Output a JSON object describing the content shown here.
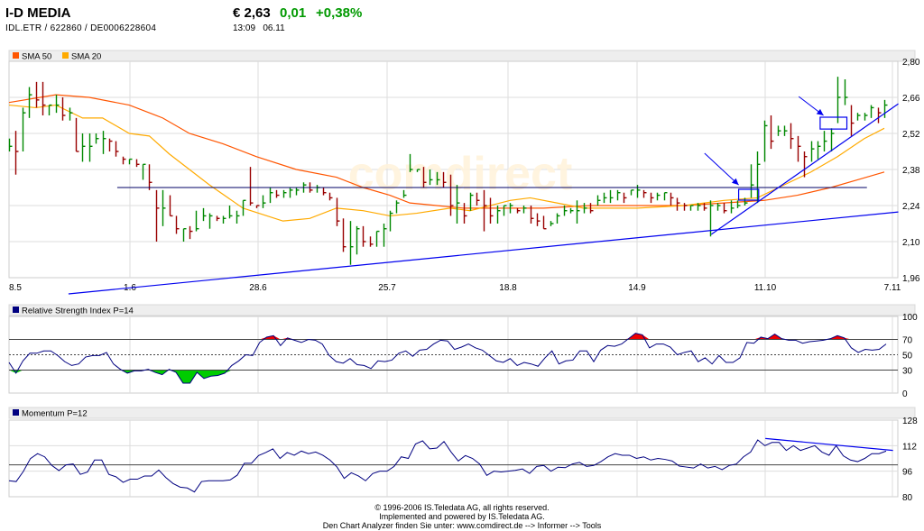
{
  "header": {
    "title": "I-D MEDIA",
    "identifiers": "IDL.ETR  /  622860  /  DE0006228604",
    "price": "€ 2,63",
    "change": "0,01",
    "change_pct": "+0,38%",
    "time": "13:09",
    "date": "06.11"
  },
  "colors": {
    "up": "#008800",
    "down": "#990000",
    "sma50": "#ff5500",
    "sma20": "#ffaa00",
    "trend": "#0000ee",
    "rsi": "#000080",
    "overbought": "#ee0000",
    "oversold": "#00cc00"
  },
  "watermark": "comdirect",
  "footer": {
    "line1": "© 1996-2006 IS.Teledata AG, all rights reserved.",
    "line2": "Implemented and powered by IS.Teledata AG.",
    "line3": "Den Chart Analyzer finden Sie unter: www.comdirect.de --> Informer --> Tools"
  },
  "chart_data": [
    {
      "type": "ohlc",
      "legend": [
        "SMA 50",
        "SMA 20"
      ],
      "x_tick_labels": [
        "8.5",
        "1.6",
        "28.6",
        "25.7",
        "18.8",
        "14.9",
        "11.10",
        "7.11"
      ],
      "y_tick_labels": [
        "2,80",
        "2,66",
        "2,52",
        "2,38",
        "2,24",
        "2,10",
        "1,96"
      ],
      "ylim": [
        1.96,
        2.8
      ],
      "grid": true,
      "bars_hlc": [
        [
          2.5,
          2.45,
          2.47
        ],
        [
          2.53,
          2.36,
          2.45
        ],
        [
          2.62,
          2.45,
          2.6
        ],
        [
          2.7,
          2.58,
          2.67
        ],
        [
          2.72,
          2.62,
          2.65
        ],
        [
          2.72,
          2.59,
          2.63
        ],
        [
          2.63,
          2.59,
          2.63
        ],
        [
          2.67,
          2.6,
          2.63
        ],
        [
          2.66,
          2.57,
          2.59
        ],
        [
          2.62,
          2.57,
          2.6
        ],
        [
          2.58,
          2.45,
          2.45
        ],
        [
          2.52,
          2.41,
          2.47
        ],
        [
          2.52,
          2.41,
          2.47
        ],
        [
          2.52,
          2.48,
          2.5
        ],
        [
          2.53,
          2.44,
          2.5
        ],
        [
          2.5,
          2.45,
          2.49
        ],
        [
          2.49,
          2.43,
          2.45
        ],
        [
          2.43,
          2.4,
          2.42
        ],
        [
          2.42,
          2.4,
          2.42
        ],
        [
          2.42,
          2.39,
          2.4
        ],
        [
          2.4,
          2.34,
          2.4
        ],
        [
          2.4,
          2.3,
          2.33
        ],
        [
          2.3,
          2.1,
          2.23
        ],
        [
          2.3,
          2.16,
          2.23
        ],
        [
          2.28,
          2.2,
          2.2
        ],
        [
          2.2,
          2.13,
          2.15
        ],
        [
          2.15,
          2.1,
          2.15
        ],
        [
          2.16,
          2.11,
          2.14
        ],
        [
          2.22,
          2.14,
          2.15
        ],
        [
          2.23,
          2.18,
          2.2
        ],
        [
          2.21,
          2.15,
          2.2
        ],
        [
          2.2,
          2.18,
          2.19
        ],
        [
          2.2,
          2.17,
          2.19
        ],
        [
          2.24,
          2.19,
          2.2
        ],
        [
          2.22,
          2.17,
          2.2
        ],
        [
          2.26,
          2.2,
          2.26
        ],
        [
          2.39,
          2.24,
          2.25
        ],
        [
          2.24,
          2.23,
          2.24
        ],
        [
          2.28,
          2.23,
          2.25
        ],
        [
          2.31,
          2.25,
          2.29
        ],
        [
          2.3,
          2.27,
          2.28
        ],
        [
          2.3,
          2.27,
          2.29
        ],
        [
          2.31,
          2.27,
          2.3
        ],
        [
          2.31,
          2.28,
          2.3
        ],
        [
          2.33,
          2.29,
          2.32
        ],
        [
          2.33,
          2.29,
          2.3
        ],
        [
          2.32,
          2.29,
          2.31
        ],
        [
          2.31,
          2.28,
          2.29
        ],
        [
          2.29,
          2.26,
          2.27
        ],
        [
          2.27,
          2.16,
          2.18
        ],
        [
          2.19,
          2.06,
          2.08
        ],
        [
          2.18,
          2.01,
          2.08
        ],
        [
          2.16,
          2.05,
          2.15
        ],
        [
          2.16,
          2.08,
          2.1
        ],
        [
          2.12,
          2.08,
          2.09
        ],
        [
          2.14,
          2.08,
          2.14
        ],
        [
          2.17,
          2.08,
          2.15
        ],
        [
          2.22,
          2.14,
          2.21
        ],
        [
          2.26,
          2.21,
          2.25
        ],
        [
          2.3,
          2.27,
          2.28
        ],
        [
          2.44,
          2.37,
          2.38
        ],
        [
          2.38,
          2.37,
          2.38
        ],
        [
          2.39,
          2.31,
          2.33
        ],
        [
          2.38,
          2.32,
          2.34
        ],
        [
          2.37,
          2.32,
          2.34
        ],
        [
          2.37,
          2.31,
          2.33
        ],
        [
          2.36,
          2.2,
          2.24
        ],
        [
          2.32,
          2.17,
          2.25
        ],
        [
          2.25,
          2.17,
          2.2
        ],
        [
          2.29,
          2.22,
          2.28
        ],
        [
          2.29,
          2.24,
          2.26
        ],
        [
          2.3,
          2.14,
          2.24
        ],
        [
          2.27,
          2.17,
          2.2
        ],
        [
          2.24,
          2.17,
          2.22
        ],
        [
          2.24,
          2.2,
          2.24
        ],
        [
          2.25,
          2.21,
          2.24
        ],
        [
          2.23,
          2.21,
          2.22
        ],
        [
          2.24,
          2.21,
          2.23
        ],
        [
          2.24,
          2.17,
          2.19
        ],
        [
          2.21,
          2.16,
          2.18
        ],
        [
          2.2,
          2.15,
          2.15
        ],
        [
          2.18,
          2.16,
          2.17
        ],
        [
          2.21,
          2.17,
          2.2
        ],
        [
          2.24,
          2.2,
          2.22
        ],
        [
          2.23,
          2.21,
          2.22
        ],
        [
          2.26,
          2.17,
          2.22
        ],
        [
          2.25,
          2.21,
          2.23
        ],
        [
          2.25,
          2.21,
          2.22
        ],
        [
          2.28,
          2.24,
          2.26
        ],
        [
          2.29,
          2.25,
          2.27
        ],
        [
          2.3,
          2.25,
          2.27
        ],
        [
          2.3,
          2.26,
          2.29
        ],
        [
          2.29,
          2.25,
          2.27
        ],
        [
          2.3,
          2.28,
          2.3
        ],
        [
          2.32,
          2.27,
          2.3
        ],
        [
          2.3,
          2.27,
          2.29
        ],
        [
          2.29,
          2.25,
          2.27
        ],
        [
          2.29,
          2.26,
          2.28
        ],
        [
          2.29,
          2.26,
          2.29
        ],
        [
          2.29,
          2.24,
          2.27
        ],
        [
          2.27,
          2.22,
          2.25
        ],
        [
          2.25,
          2.22,
          2.24
        ],
        [
          2.24,
          2.22,
          2.24
        ],
        [
          2.25,
          2.22,
          2.24
        ],
        [
          2.25,
          2.22,
          2.23
        ],
        [
          2.26,
          2.12,
          2.24
        ],
        [
          2.25,
          2.22,
          2.24
        ],
        [
          2.25,
          2.21,
          2.22
        ],
        [
          2.26,
          2.21,
          2.23
        ],
        [
          2.26,
          2.23,
          2.24
        ],
        [
          2.27,
          2.24,
          2.25
        ],
        [
          2.4,
          2.27,
          2.32
        ],
        [
          2.45,
          2.25,
          2.4
        ],
        [
          2.57,
          2.41,
          2.55
        ],
        [
          2.59,
          2.46,
          2.49
        ],
        [
          2.55,
          2.51,
          2.53
        ],
        [
          2.55,
          2.51,
          2.53
        ],
        [
          2.56,
          2.46,
          2.5
        ],
        [
          2.51,
          2.41,
          2.47
        ],
        [
          2.45,
          2.35,
          2.43
        ],
        [
          2.49,
          2.41,
          2.46
        ],
        [
          2.49,
          2.42,
          2.47
        ],
        [
          2.53,
          2.45,
          2.49
        ],
        [
          2.54,
          2.45,
          2.52
        ],
        [
          2.74,
          2.56,
          2.66
        ],
        [
          2.73,
          2.63,
          2.66
        ],
        [
          2.63,
          2.51,
          2.56
        ],
        [
          2.6,
          2.57,
          2.59
        ],
        [
          2.6,
          2.57,
          2.59
        ],
        [
          2.63,
          2.58,
          2.62
        ],
        [
          2.62,
          2.56,
          2.6
        ],
        [
          2.65,
          2.58,
          2.63
        ]
      ],
      "sma50": [
        [
          0,
          2.64
        ],
        [
          7,
          2.67
        ],
        [
          12,
          2.66
        ],
        [
          18,
          2.63
        ],
        [
          23,
          2.58
        ],
        [
          27,
          2.52
        ],
        [
          32,
          2.48
        ],
        [
          37,
          2.43
        ],
        [
          43,
          2.38
        ],
        [
          49,
          2.35
        ],
        [
          53,
          2.31
        ],
        [
          57,
          2.28
        ],
        [
          60,
          2.25
        ],
        [
          64,
          2.24
        ],
        [
          68,
          2.23
        ],
        [
          75,
          2.23
        ],
        [
          80,
          2.23
        ],
        [
          87,
          2.24
        ],
        [
          94,
          2.24
        ],
        [
          101,
          2.24
        ],
        [
          107,
          2.25
        ],
        [
          113,
          2.26
        ],
        [
          118,
          2.28
        ],
        [
          123,
          2.31
        ],
        [
          127,
          2.34
        ],
        [
          131,
          2.37
        ]
      ],
      "sma20": [
        [
          0,
          2.63
        ],
        [
          4,
          2.62
        ],
        [
          7,
          2.63
        ],
        [
          11,
          2.58
        ],
        [
          14,
          2.58
        ],
        [
          18,
          2.52
        ],
        [
          21,
          2.51
        ],
        [
          24,
          2.44
        ],
        [
          30,
          2.32
        ],
        [
          35,
          2.23
        ],
        [
          41,
          2.18
        ],
        [
          45,
          2.19
        ],
        [
          49,
          2.23
        ],
        [
          53,
          2.22
        ],
        [
          57,
          2.2
        ],
        [
          61,
          2.21
        ],
        [
          66,
          2.23
        ],
        [
          69,
          2.22
        ],
        [
          75,
          2.26
        ],
        [
          78,
          2.27
        ],
        [
          82,
          2.25
        ],
        [
          86,
          2.23
        ],
        [
          94,
          2.23
        ],
        [
          101,
          2.24
        ],
        [
          107,
          2.26
        ],
        [
          112,
          2.27
        ],
        [
          116,
          2.32
        ],
        [
          120,
          2.37
        ],
        [
          124,
          2.43
        ],
        [
          128,
          2.5
        ],
        [
          131,
          2.54
        ]
      ],
      "annotations": {
        "hline": {
          "from": 16.2,
          "to": 128.4,
          "price": 2.31
        },
        "lines": [
          {
            "x1": 8.9,
            "p1": 1.897,
            "x2": 133.1,
            "p2": 2.215
          },
          {
            "x1": 105.1,
            "p1": 2.128,
            "x2": 133.1,
            "p2": 2.635
          }
        ],
        "rects": [
          {
            "x1": 109.2,
            "x2": 112.2,
            "p1": 2.303,
            "p2": 2.261
          },
          {
            "x1": 121.4,
            "x2": 125.4,
            "p1": 2.583,
            "p2": 2.537
          }
        ],
        "arrows": [
          {
            "x1": 104.1,
            "p1": 2.443,
            "x2": 109.2,
            "p2": 2.32
          },
          {
            "x1": 118.2,
            "p1": 2.663,
            "x2": 121.9,
            "p2": 2.59
          }
        ]
      }
    },
    {
      "type": "line",
      "title": "Relative Strength Index P=14",
      "y_tick_labels": [
        "100",
        "70",
        "50",
        "30",
        "0"
      ],
      "ylim": [
        0,
        100
      ],
      "levels": [
        30,
        50,
        70
      ],
      "values": [
        40,
        26,
        42,
        52,
        52,
        55,
        55,
        49,
        41,
        36,
        38,
        47,
        49,
        49,
        53,
        38,
        31,
        26,
        29,
        29,
        31,
        27,
        24,
        31,
        27,
        13,
        13,
        27,
        19,
        22,
        23,
        26,
        36,
        42,
        50,
        49,
        66,
        73,
        75,
        62,
        72,
        69,
        66,
        70,
        69,
        64,
        49,
        41,
        39,
        45,
        37,
        36,
        32,
        42,
        41,
        43,
        52,
        55,
        48,
        56,
        57,
        64,
        69,
        68,
        57,
        60,
        64,
        59,
        56,
        49,
        42,
        40,
        45,
        36,
        40,
        38,
        35,
        46,
        55,
        38,
        42,
        43,
        55,
        55,
        41,
        56,
        62,
        61,
        64,
        71,
        78,
        76,
        59,
        64,
        64,
        60,
        50,
        53,
        55,
        41,
        46,
        38,
        49,
        40,
        40,
        46,
        66,
        65,
        73,
        71,
        77,
        71,
        69,
        69,
        65,
        67,
        68,
        69,
        71,
        75,
        72,
        59,
        53,
        57,
        56,
        57,
        64
      ]
    },
    {
      "type": "line",
      "title": "Momentum P=12",
      "y_tick_labels": [
        "128",
        "112",
        "96",
        "80"
      ],
      "ylim": [
        80,
        128
      ],
      "baseline": 100,
      "values": [
        90,
        89.5,
        95.8,
        103.9,
        107,
        105,
        99.6,
        96.4,
        100,
        100.5,
        94,
        95.5,
        103,
        103,
        94,
        92.5,
        89,
        91,
        91,
        93,
        93,
        96.7,
        92,
        88.3,
        86,
        85.5,
        83,
        89.5,
        90,
        90,
        90,
        90.5,
        93.5,
        101,
        101,
        105.8,
        107.7,
        110,
        104,
        107.7,
        106,
        108.6,
        107,
        108,
        106,
        103,
        98.6,
        91.5,
        95,
        93,
        90,
        94.5,
        96,
        96,
        99,
        105,
        104,
        113,
        115,
        110,
        110.5,
        114.6,
        108,
        102.4,
        105.8,
        104,
        100.5,
        93.4,
        96,
        95.5,
        96,
        96.5,
        97.4,
        94.6,
        99,
        99.6,
        96,
        98.5,
        98.2,
        100.5,
        101.5,
        99,
        99.6,
        102,
        105,
        107,
        106,
        106,
        104,
        105,
        103,
        104,
        103.4,
        102.4,
        99.2,
        98.6,
        98,
        100.5,
        98,
        99,
        97,
        99.6,
        100.5,
        105,
        108,
        115.6,
        112,
        114,
        114,
        109,
        112,
        109,
        110.5,
        112,
        108,
        106,
        112,
        105.6,
        103,
        102,
        104,
        107,
        107,
        108.6
      ],
      "trendline": {
        "x1": 113.2,
        "v1": 116.5,
        "x2": 132.3,
        "v2": 109
      }
    }
  ]
}
